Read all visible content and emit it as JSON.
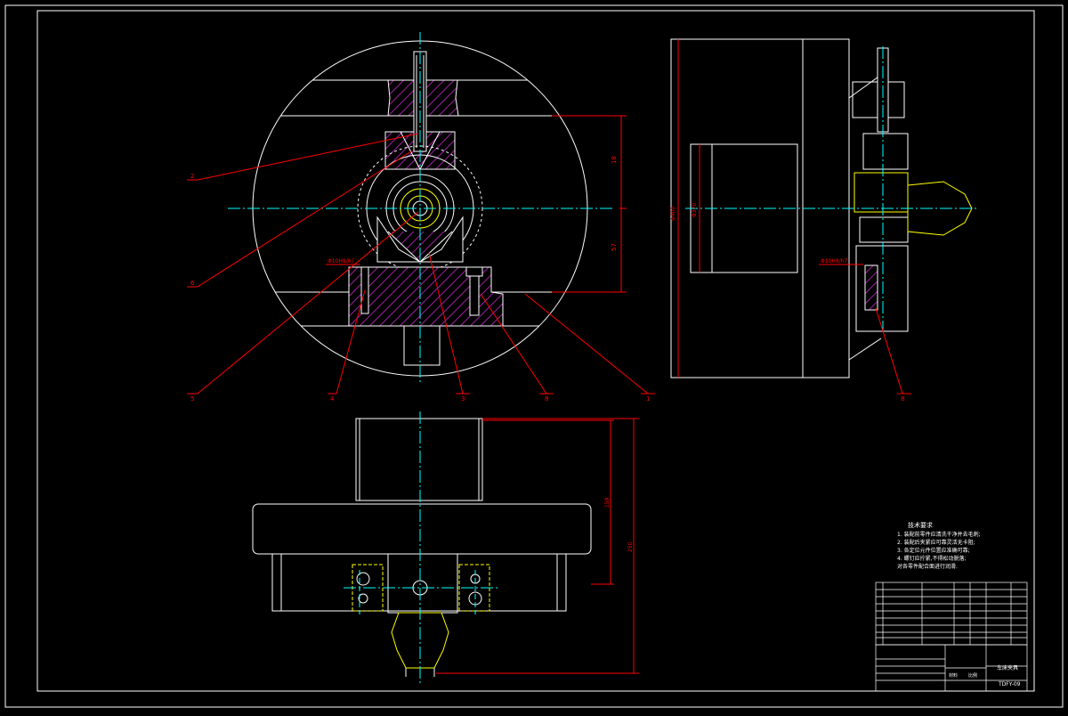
{
  "drawing": {
    "balloons": {
      "b1": "1",
      "b2": "2",
      "b3": "3",
      "b4": "4",
      "b5": "5",
      "b6": "6",
      "b7": "7",
      "b8": "8",
      "b9": "8"
    },
    "dims": {
      "d_height_top": "18",
      "d_height_bottom": "57",
      "d_fit_left": "Φ10H8/h7",
      "d_fit_right": "Φ10H8/h7",
      "d_side_outer": "Φ400",
      "d_side_inner": "Φ370",
      "d_bottom_inner": "159",
      "d_bottom_outer": "250"
    },
    "tech_req": {
      "title": "技术要求",
      "lines": [
        "1. 装配前零件应清洗干净并去毛刺;",
        "2. 装配后夹紧应可靠灵活无卡阻;",
        "3. 各定位元件位置应准确可靠;",
        "4. 螺钉应拧紧,不得松动脱落;",
        "对各零件配合面进行润滑."
      ]
    },
    "title_block": {
      "name": "车床夹具",
      "code": "TDFY-09",
      "material_label": "材料",
      "ratio_label": "比例"
    },
    "colors": {
      "outline": "#ffffff",
      "center": "#00ffff",
      "leader": "#ff0000",
      "hatch": "#a020a0",
      "aux": "#ffff00"
    }
  }
}
